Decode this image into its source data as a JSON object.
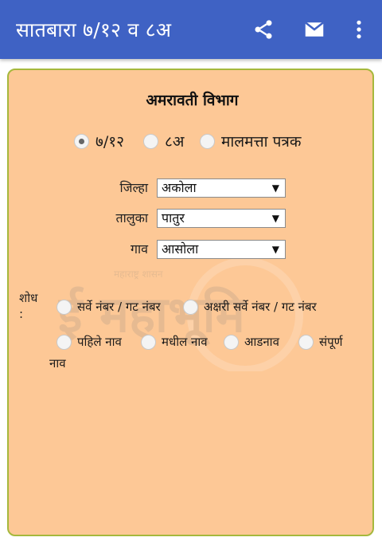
{
  "appbar": {
    "title": "सातबारा ७/१२ व ८अ",
    "color": "#3f62c4",
    "actions": [
      {
        "icon": "share-icon"
      },
      {
        "icon": "mail-icon"
      },
      {
        "icon": "more-vertical-icon"
      }
    ]
  },
  "card": {
    "heading": "अमरावती विभाग",
    "background": "#fdc896",
    "border_color": "#a6b83c",
    "record_types": [
      {
        "label": "७/१२",
        "selected": true
      },
      {
        "label": "८अ",
        "selected": false
      },
      {
        "label": "मालमत्ता पत्रक",
        "selected": false
      }
    ],
    "fields": {
      "district": {
        "label": "जिल्हा",
        "value": "अकोला"
      },
      "taluka": {
        "label": "तालुका",
        "value": "पातुर"
      },
      "village": {
        "label": "गाव",
        "value": "आसोला"
      }
    },
    "search": {
      "label": "शोध :",
      "options": [
        {
          "label": "सर्वे नंबर / गट नंबर",
          "selected": false
        },
        {
          "label": "अक्षरी सर्वे नंबर / गट नंबर",
          "selected": false
        },
        {
          "label": "पहिले नाव",
          "selected": false
        },
        {
          "label": "मधील नाव",
          "selected": false
        },
        {
          "label": "आडनाव",
          "selected": false
        },
        {
          "label": "संपूर्ण",
          "selected": false
        }
      ],
      "wrapped_tail": "नाव"
    },
    "watermark": {
      "text": "ई महाभूमि",
      "small_text": "महाराष्ट्र शासन"
    }
  }
}
